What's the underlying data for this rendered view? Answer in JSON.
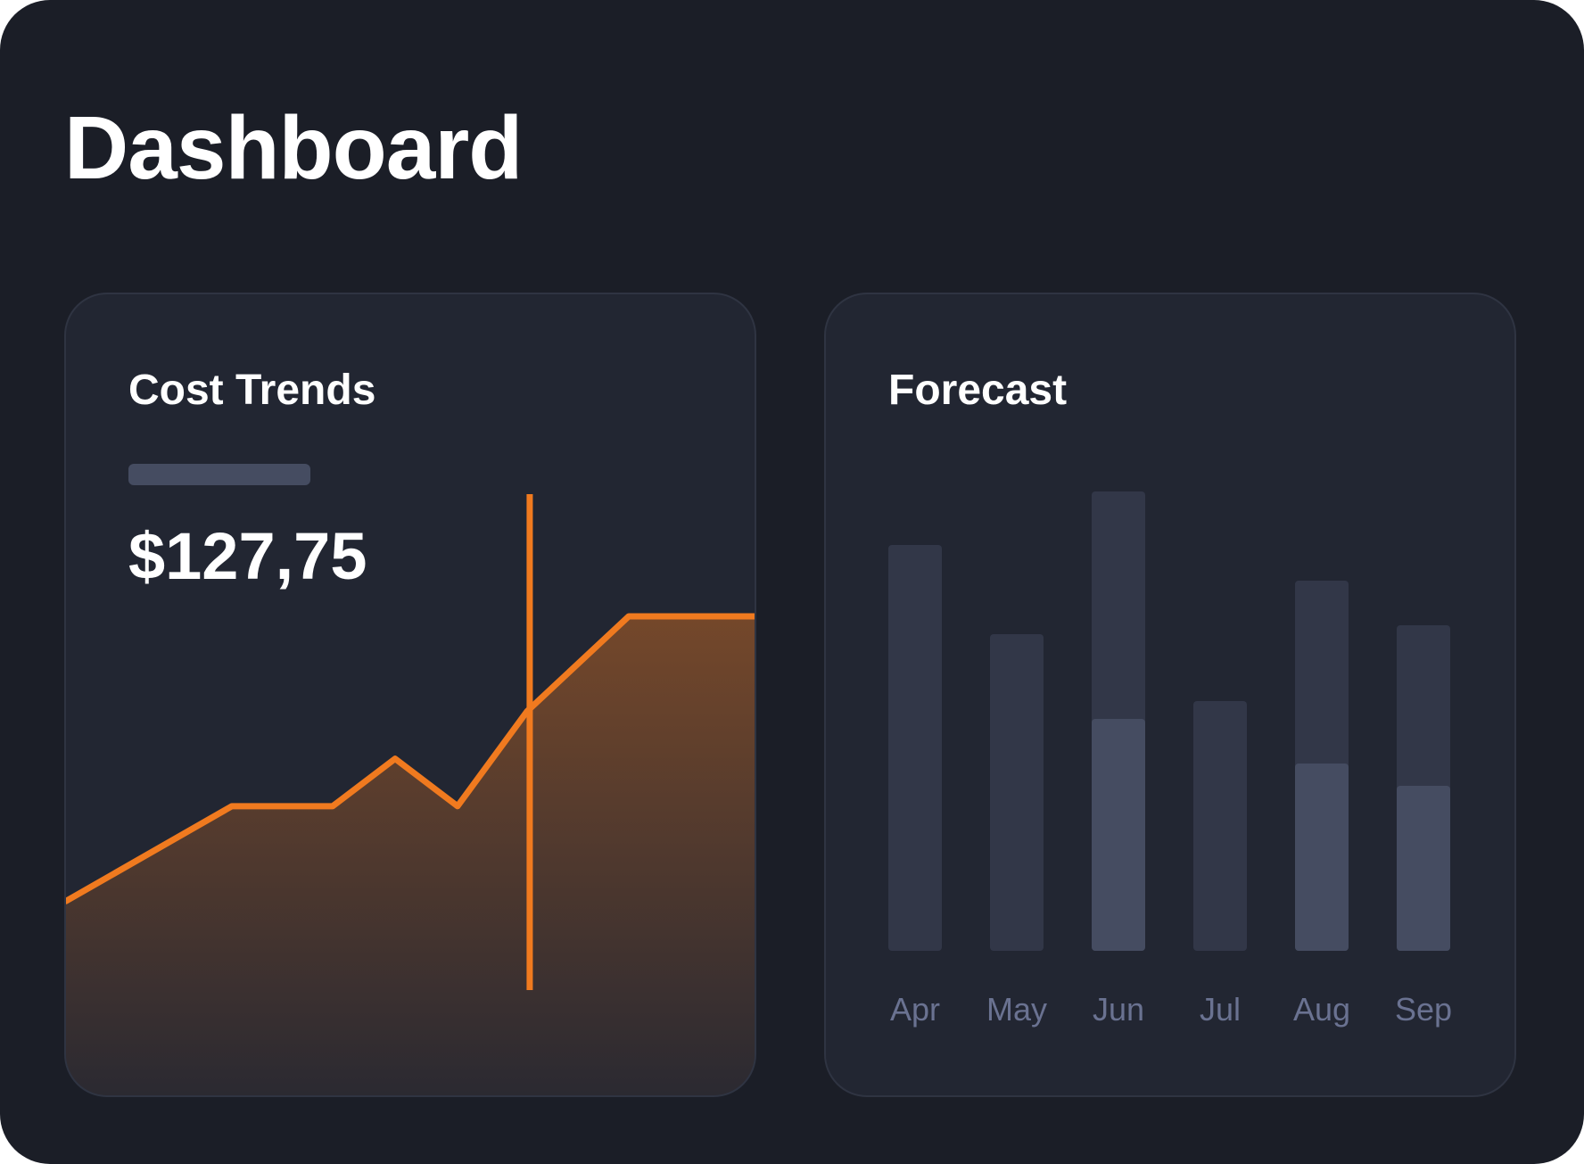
{
  "page": {
    "title": "Dashboard"
  },
  "colors": {
    "background": "#1b1e27",
    "card": "#222632",
    "card_border": "#2f3442",
    "accent": "#f07a1f",
    "bar_track": "#323748",
    "bar_fill": "#454c61",
    "label": "#6a7291"
  },
  "cost_trends": {
    "title": "Cost Trends",
    "value": "$127,75",
    "cursor_position": 0.67
  },
  "forecast": {
    "title": "Forecast"
  },
  "chart_data": [
    {
      "type": "area",
      "title": "Cost Trends",
      "x": [
        0,
        1,
        2,
        3,
        4,
        5,
        6,
        7,
        8
      ],
      "values": [
        27,
        51,
        51,
        63,
        51,
        75,
        99,
        99,
        99
      ],
      "ylim": [
        0,
        115
      ],
      "grid": false,
      "color": "#f07a1f"
    },
    {
      "type": "bar",
      "title": "Forecast",
      "categories": [
        "Apr",
        "May",
        "Jun",
        "Jul",
        "Aug",
        "Sep"
      ],
      "series": [
        {
          "values": [
            91,
            71,
            103,
            56,
            83,
            73
          ]
        },
        {
          "values": [
            0,
            0,
            52,
            0,
            42,
            37
          ]
        }
      ],
      "ylim": [
        0,
        110
      ],
      "grid": false
    }
  ]
}
